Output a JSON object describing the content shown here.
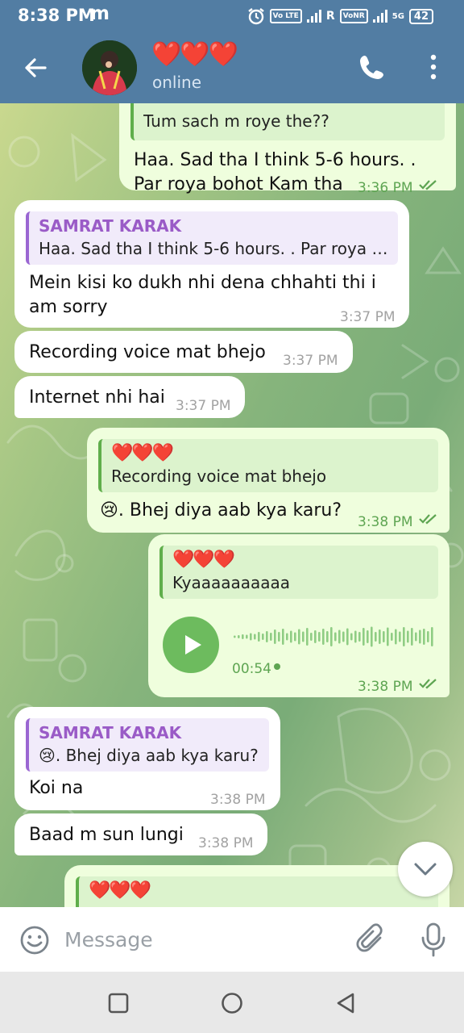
{
  "status_bar": {
    "time": "8:38 PM",
    "carrier_glyph": "m",
    "volte_1": "Vo LTE",
    "network_r": "R",
    "vonr": "VoNR",
    "net_5g": "5G",
    "battery": "42",
    "icons": [
      "alarm-icon",
      "signal-icon",
      "battery-icon"
    ]
  },
  "header": {
    "title": "❤️❤️❤️",
    "status": "online",
    "icons": [
      "back-arrow-icon",
      "phone-icon",
      "more-vertical-icon"
    ]
  },
  "messages": [
    {
      "direction": "outgoing",
      "reply_text": "Tum sach m roye the??",
      "line1": "Haa. Sad tha I think 5-6 hours. .",
      "line2": "Par roya bohot Kam tha",
      "time": "3:36 PM",
      "read": true
    },
    {
      "direction": "incoming",
      "reply_name": "SAMRAT KARAK",
      "reply_text": "Haa. Sad tha I think 5-6 hours. . Par roya bohot Kam tha",
      "line1": "Mein kisi ko dukh nhi dena chhahti thi i",
      "line2": "am sorry",
      "time": "3:37 PM"
    },
    {
      "direction": "incoming",
      "text": "Recording voice mat bhejo",
      "time": "3:37 PM"
    },
    {
      "direction": "incoming",
      "text": "Internet nhi hai",
      "time": "3:37 PM"
    },
    {
      "direction": "outgoing",
      "reply_name": "❤️❤️❤️",
      "reply_text": "Recording voice mat bhejo",
      "text": "😢. Bhej diya aab kya karu?",
      "time": "3:38 PM",
      "read": true
    },
    {
      "direction": "outgoing",
      "type": "voice",
      "reply_name": "❤️❤️❤️",
      "reply_text": "Kyaaaaaaaaaa",
      "duration": "00:54",
      "time": "3:38 PM",
      "read": true
    },
    {
      "direction": "incoming",
      "reply_name": "SAMRAT KARAK",
      "reply_text": "😢. Bhej diya aab kya karu?",
      "text": "Koi na",
      "time": "3:38 PM"
    },
    {
      "direction": "incoming",
      "text": "Baad m sun lungi",
      "time": "3:38 PM"
    },
    {
      "direction": "outgoing",
      "reply_name": "❤️❤️❤️"
    }
  ],
  "voice_waveform": [
    3,
    4,
    6,
    5,
    9,
    7,
    12,
    8,
    14,
    10,
    18,
    12,
    20,
    9,
    15,
    11,
    19,
    13,
    22,
    10,
    16,
    12,
    20,
    14,
    24,
    11,
    17,
    13,
    21,
    9,
    15,
    12,
    22,
    16,
    25,
    12,
    18,
    14,
    23,
    10,
    19,
    13,
    24,
    15,
    22,
    11,
    17,
    20,
    14,
    24
  ],
  "input_bar": {
    "placeholder": "Message",
    "icons": [
      "emoji-icon",
      "attach-icon",
      "mic-icon"
    ]
  },
  "colors": {
    "header": "#527da3",
    "incoming_bubble": "#ffffff",
    "outgoing_bubble": "#effedd",
    "reply_name": "#9a5bc7",
    "read_tick": "#5ea552",
    "play_button": "#6dbb5e"
  }
}
